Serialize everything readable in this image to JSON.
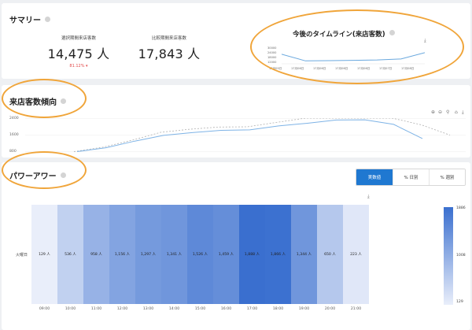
{
  "summary": {
    "title": "サマリー",
    "stats": [
      {
        "label": "選択期間来店客数",
        "value": "14,475 人",
        "change": "81.12% ▾"
      },
      {
        "label": "比較期間来店客数",
        "value": "17,843 人"
      }
    ],
    "timeline": {
      "title": "今後のタイムライン(来店客数)",
      "y_ticks": [
        "30000",
        "24000",
        "18000",
        "12000"
      ],
      "x_ticks": [
        "17月05日",
        "17月06日",
        "17月06日",
        "17月06日",
        "17月06日",
        "17月07日",
        "17月08日"
      ],
      "values": [
        22000,
        15000,
        15300,
        15600,
        16000,
        17000,
        23500
      ],
      "ylim": [
        12000,
        30000
      ],
      "line_color": "#6aa8de"
    }
  },
  "trend": {
    "title": "来店客数傾向",
    "y_ticks": [
      "2400",
      "1600",
      "800"
    ],
    "ylim": [
      0,
      2400
    ],
    "solid": [
      0,
      280,
      760,
      1180,
      1380,
      1540,
      1580,
      1860,
      2060,
      2290,
      2310,
      1980,
      950
    ],
    "dashed": [
      0,
      320,
      820,
      1400,
      1620,
      1780,
      1800,
      2120,
      2780,
      2700,
      2650,
      2560,
      1950,
      1200
    ],
    "solid_color": "#7eb3e6",
    "dashed_color": "#b0b0b0"
  },
  "power": {
    "title": "パワーアワー",
    "toggle": [
      "実数値",
      "% 日別",
      "% 週別"
    ],
    "row_label": "火曜日",
    "hours": [
      "09:00",
      "10:00",
      "11:00",
      "12:00",
      "13:00",
      "14:00",
      "15:00",
      "16:00",
      "17:00",
      "18:00",
      "19:00",
      "20:00",
      "21:00"
    ],
    "counts": [
      129,
      536,
      958,
      1156,
      1297,
      1341,
      1526,
      1459,
      1888,
      1866,
      1344,
      650,
      223
    ],
    "cells": [
      "129 人",
      "536 人",
      "958 人",
      "1,156 人",
      "1,297 人",
      "1,341 人",
      "1,526 人",
      "1,459 人",
      "1,888 人",
      "1,866 人",
      "1,344 人",
      "650 人",
      "223 人"
    ],
    "legend": [
      "1886",
      "1008",
      "129"
    ],
    "color_low": "#e9eefa",
    "color_high": "#3a6fcf"
  }
}
